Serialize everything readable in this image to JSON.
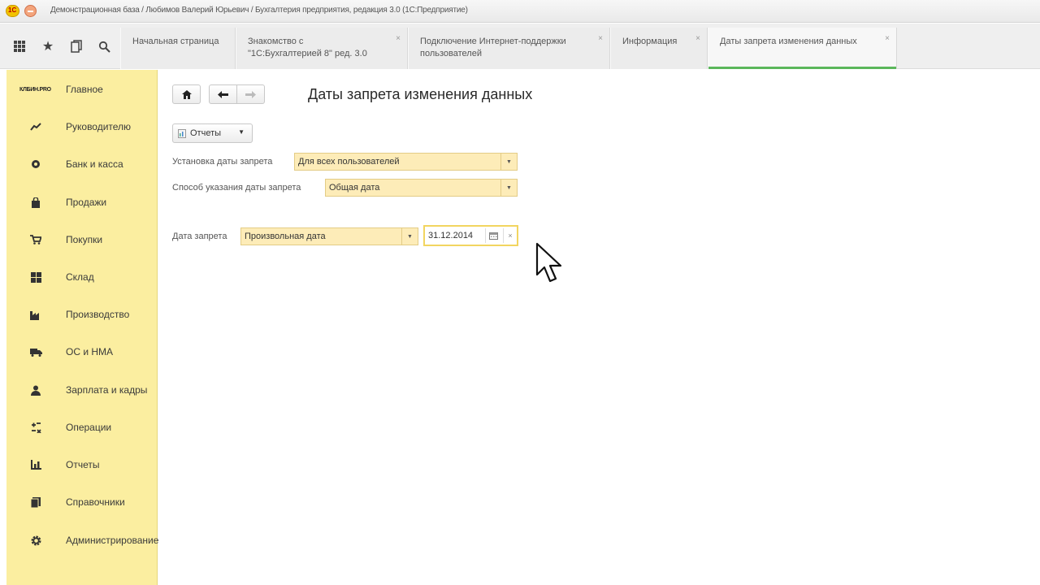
{
  "window": {
    "title": "Демонстрационная база / Любимов Валерий Юрьевич / Бухгалтерия предприятия, редакция 3.0  (1С:Предприятие)"
  },
  "toolbar": {
    "icons": [
      "grid-icon",
      "star-icon",
      "history-icon",
      "search-icon"
    ]
  },
  "tabs": [
    {
      "label": "Начальная страница",
      "closable": false,
      "active": false
    },
    {
      "label": "Знакомство с\n\"1С:Бухгалтерией 8\" ред. 3.0",
      "closable": true,
      "active": false
    },
    {
      "label": "Подключение Интернет-поддержки\nпользователей",
      "closable": true,
      "active": false
    },
    {
      "label": "Информация",
      "closable": true,
      "active": false
    },
    {
      "label": "Даты запрета изменения данных",
      "closable": true,
      "active": true
    }
  ],
  "tab_close_glyph": "×",
  "sidebar": {
    "logo": "КЛБИН.PRO",
    "items": [
      {
        "label": "Главное",
        "icon": "logo"
      },
      {
        "label": "Руководителю",
        "icon": "trend-icon"
      },
      {
        "label": "Банк и касса",
        "icon": "coins-icon"
      },
      {
        "label": "Продажи",
        "icon": "bag-icon"
      },
      {
        "label": "Покупки",
        "icon": "cart-icon"
      },
      {
        "label": "Склад",
        "icon": "warehouse-icon"
      },
      {
        "label": "Производство",
        "icon": "factory-icon"
      },
      {
        "label": "ОС и НМА",
        "icon": "truck-icon"
      },
      {
        "label": "Зарплата и кадры",
        "icon": "person-icon"
      },
      {
        "label": "Операции",
        "icon": "operations-icon"
      },
      {
        "label": "Отчеты",
        "icon": "chart-icon"
      },
      {
        "label": "Справочники",
        "icon": "book-icon"
      },
      {
        "label": "Администрирование",
        "icon": "gear-icon"
      }
    ]
  },
  "page": {
    "title": "Даты запрета изменения данных",
    "reports_button": "Отчеты",
    "setup_label": "Установка даты запрета",
    "setup_value": "Для всех пользователей",
    "method_label": "Способ указания даты запрета",
    "method_value": "Общая дата",
    "date_label": "Дата запрета",
    "date_kind": "Произвольная дата",
    "date_value": "31.12.2014"
  },
  "colors": {
    "sidebar_bg": "#fbeea0",
    "field_bg": "#fdecb8",
    "active_tab_accent": "#5bb75b"
  }
}
